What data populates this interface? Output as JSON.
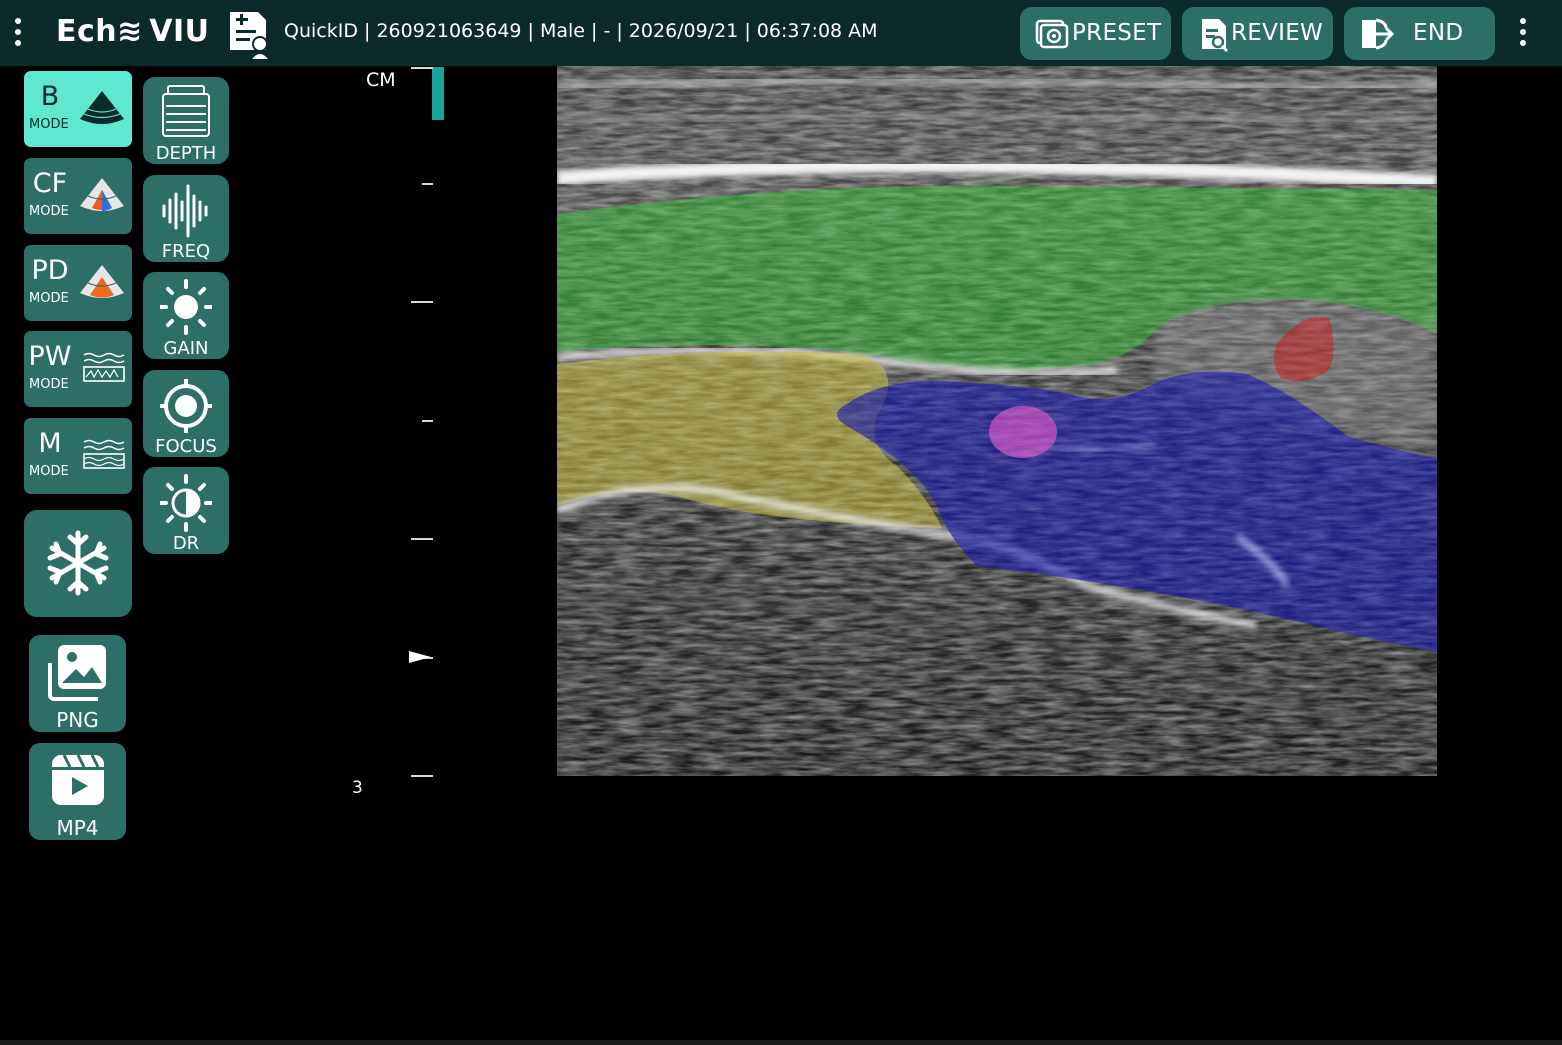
{
  "header": {
    "logo": "Ech≋ VIU",
    "patient_info": "QuickID | 260921063649 | Male | - | 2026/09/21 | 06:37:08 AM",
    "buttons": {
      "preset": "PRESET",
      "review": "REVIEW",
      "end": "END"
    }
  },
  "modes": {
    "b": {
      "big": "B",
      "small": "MODE",
      "active": true
    },
    "cf": {
      "big": "CF",
      "small": "MODE",
      "active": false
    },
    "pd": {
      "big": "PD",
      "small": "MODE",
      "active": false
    },
    "pw": {
      "big": "PW",
      "small": "MODE",
      "active": false
    },
    "m": {
      "big": "M",
      "small": "MODE",
      "active": false
    }
  },
  "params": {
    "depth": "DEPTH",
    "freq": "FREQ",
    "gain": "GAIN",
    "focus": "FOCUS",
    "dr": "DR"
  },
  "capture": {
    "png": "PNG",
    "mp4": "MP4"
  },
  "scale": {
    "unit": "CM",
    "max_depth": "3"
  },
  "colors": {
    "topbar": "#0b2a2a",
    "button": "#2d6f67",
    "active_mode": "#5ee8cf",
    "depth_indicator": "#17a59a",
    "overlay_green": "#34b634",
    "overlay_yellow": "#c2b538",
    "overlay_blue": "#1e1ea8",
    "overlay_magenta": "#d04ec0",
    "overlay_red": "#b42828"
  }
}
